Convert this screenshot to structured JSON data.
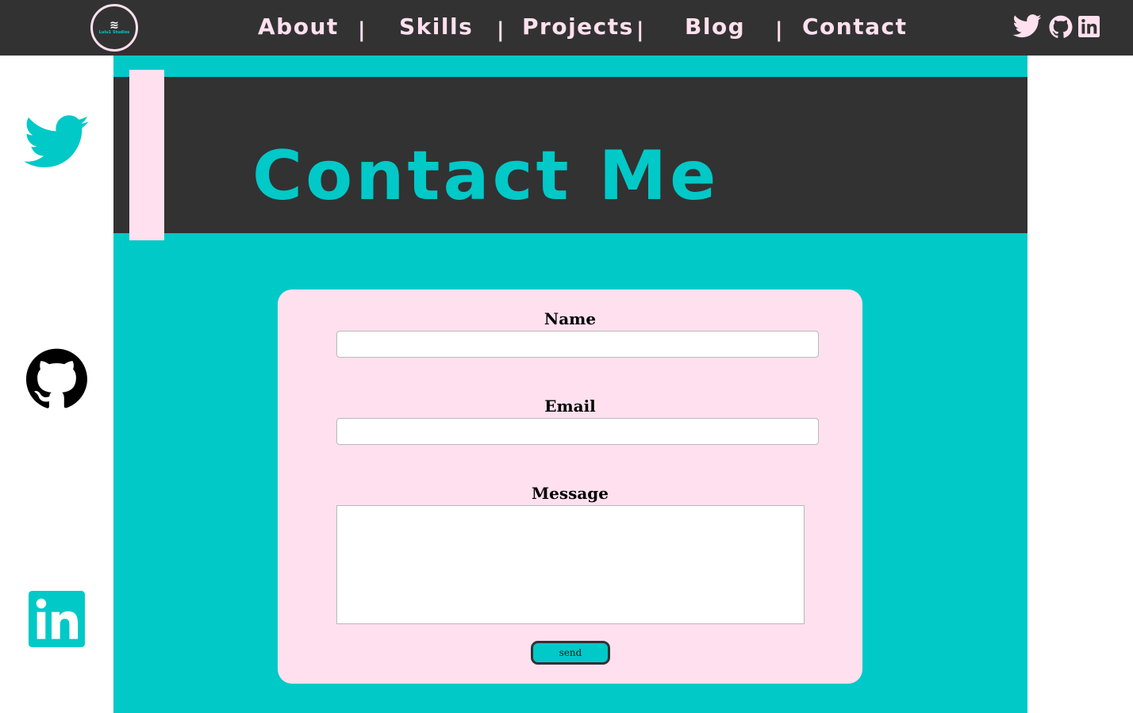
{
  "logo": {
    "text": "Lulu1 Studios",
    "icon": "waves-icon"
  },
  "nav": {
    "items": [
      {
        "label": "About"
      },
      {
        "label": "Skills"
      },
      {
        "label": "Projects"
      },
      {
        "label": "Blog"
      },
      {
        "label": "Contact"
      }
    ],
    "separator": "|"
  },
  "social": [
    "twitter-icon",
    "github-icon",
    "linkedin-icon"
  ],
  "hero": {
    "title": "Contact Me"
  },
  "form": {
    "name_label": "Name",
    "name_value": "",
    "email_label": "Email",
    "email_value": "",
    "message_label": "Message",
    "message_value": "",
    "send_label": "send"
  },
  "colors": {
    "dark": "#323232",
    "teal": "#00c9c8",
    "pink": "#ffe0ee",
    "white": "#ffffff"
  }
}
